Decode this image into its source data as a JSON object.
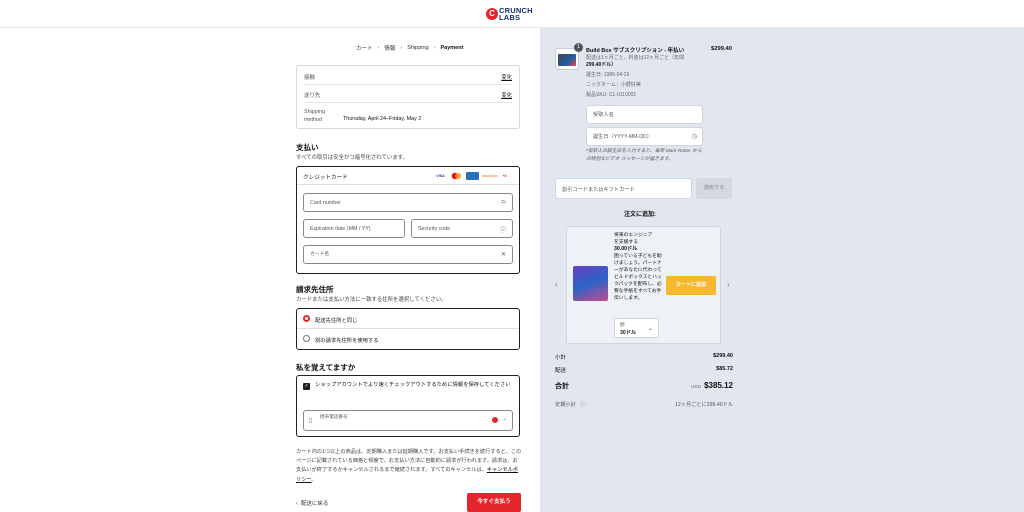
{
  "header": {
    "logo_line1": "CRUNCH",
    "logo_line2": "LABS"
  },
  "breadcrumb": [
    "カート",
    "情報",
    "Shipping",
    "Payment"
  ],
  "info": {
    "contact_label": "接触",
    "contact_change": "変化",
    "ship_to_label": "送り先",
    "ship_to_change": "変化",
    "method_label": "Shipping method",
    "method_value": "Thursday, April 24–Friday, May 2"
  },
  "payment": {
    "title": "支払い",
    "subtitle": "すべての取引は安全かつ暗号化されています。",
    "method_label": "クレジットカード",
    "cards": [
      "VISA",
      "MC",
      "AMEX",
      "DISCOVER",
      "+4"
    ],
    "card_number_ph": "Card number",
    "expiry_ph": "Expiration date (MM / YY)",
    "security_ph": "Security code",
    "name_ph": "カード名"
  },
  "billing": {
    "title": "請求先住所",
    "subtitle": "カードまたは支払い方法に一致する住所を選択してください。",
    "option_same": "配送先住所と同じ",
    "option_different": "別の請求先住所を使用する"
  },
  "remember": {
    "title": "私を覚えてますか",
    "checkbox_label": "ショップアカウントでより速くチェックアウトするために情報を保存してください",
    "phone_ph": "携帯電話番号"
  },
  "legal": {
    "text": "カート内の1つ以上の商品は、定期購入または延期購入です。お支払い手続きを続行すると、このページに記載されている価格と頻度で、お支払い方法に自動的に請求が行われます。請求は、お支払いが終了するかキャンセルされるまで継続されます。すべてのキャンセルは、",
    "link": "キャンセルポリシー",
    "end": "。"
  },
  "footer": {
    "back": "配送に戻る",
    "pay_now": "今すぐ支払う"
  },
  "order": {
    "qty_badge": "1",
    "product_title": "Build Box サブスクリプション - 年払い",
    "product_price": "$299.40",
    "line1": "配送は1ヶ月ごと、料金は12ヶ月ごと（年間",
    "line1b": "299.40ドル）",
    "birthday": "誕生日: 1986-04-26",
    "nickname": "ニックネーム：小野好美",
    "sku": "製品SKU: CL-0110001",
    "recipient_ph": "受取人名",
    "birthday_ph": "誕生日（YYYY-MM-DD）",
    "note": "*受取人の誕生日を入力すると、毎年 Mark Rober からの特別なビデオ メッセージが届きます。"
  },
  "discount": {
    "placeholder": "割引コードまたはギフトカード",
    "apply": "適用する"
  },
  "upsell": {
    "title": "注文に追加:",
    "name1": "将来のエンジニア",
    "name2": "を支援する",
    "price": "30.00ドル",
    "desc": "困っている子どもを助けましょう。パートナーがあなたに代わってビルドボックスとハックパックを配布し、必要な手紙をすべてお手伝いします。",
    "button": "カートに追加",
    "select_label": "額",
    "select_value": "30ドル"
  },
  "summary": {
    "subtotal_label": "小計",
    "subtotal": "$299.40",
    "shipping_label": "配送",
    "shipping": "$85.72",
    "total_label": "合計",
    "currency": "USD",
    "total": "$385.12",
    "recurring_label": "定期小計",
    "recurring": "12ヶ月ごとに299.40ドル"
  }
}
